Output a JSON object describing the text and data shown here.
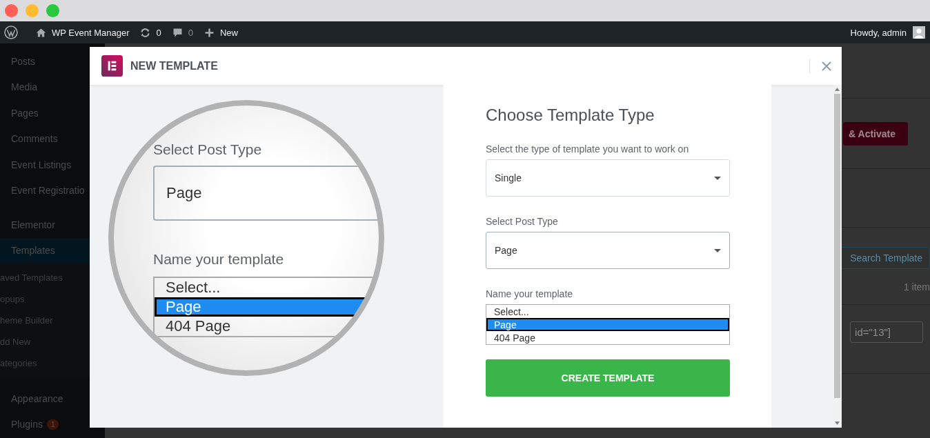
{
  "window": {
    "traffic_lights": [
      {
        "color": "#fe5f57"
      },
      {
        "color": "#febc2e"
      },
      {
        "color": "#28c840"
      }
    ]
  },
  "admin_bar": {
    "site": "WP Event Manager",
    "updates": "0",
    "comments": "0",
    "new": "New",
    "greeting": "Howdy, admin"
  },
  "sidebar": {
    "groups": [
      [
        {
          "label": "Posts",
          "selected": false
        },
        {
          "label": "Media",
          "selected": false
        },
        {
          "label": "Pages",
          "selected": false
        },
        {
          "label": "Comments",
          "selected": false
        },
        {
          "label": "Event Listings",
          "selected": false
        },
        {
          "label": "Event Registratio",
          "selected": false
        }
      ],
      [
        {
          "label": "Elementor",
          "selected": false
        },
        {
          "label": "Templates",
          "selected": true,
          "children": [
            {
              "label": "aved Templates"
            },
            {
              "label": "opups"
            },
            {
              "label": "heme Builder"
            },
            {
              "label": "dd New"
            },
            {
              "label": "ategories"
            }
          ]
        }
      ],
      [
        {
          "label": "Appearance",
          "selected": false
        },
        {
          "label": "Plugins",
          "selected": false,
          "badge": "1"
        }
      ]
    ]
  },
  "background": {
    "activate_button": "& Activate",
    "search_button": "Search Template",
    "item_count": "1 item",
    "shortcode": "id=\"13\"]"
  },
  "modal": {
    "title": "NEW TEMPLATE",
    "magnifier": {
      "post_type_label": "Select Post Type",
      "post_type_value": "Page",
      "name_label": "Name your template",
      "options": [
        {
          "label": "Select...",
          "selected": false
        },
        {
          "label": "Page",
          "selected": true
        },
        {
          "label": "404 Page",
          "selected": false
        }
      ]
    },
    "form": {
      "heading": "Choose Template Type",
      "type_label": "Select the type of template you want to work on",
      "type_value": "Single",
      "post_type_label": "Select Post Type",
      "post_type_value": "Page",
      "name_label": "Name your template",
      "options": [
        {
          "label": "Select...",
          "selected": false
        },
        {
          "label": "Page",
          "selected": true
        },
        {
          "label": "404 Page",
          "selected": false
        }
      ],
      "submit": "CREATE TEMPLATE"
    }
  }
}
